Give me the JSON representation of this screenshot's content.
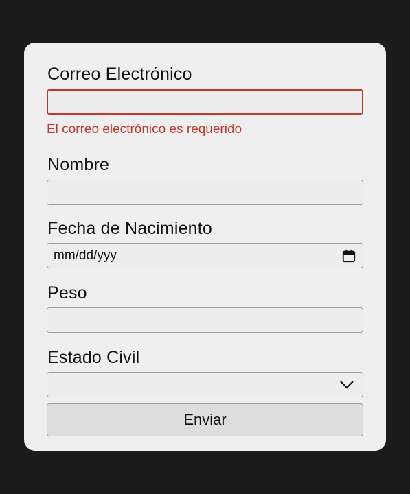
{
  "form": {
    "email": {
      "label": "Correo Electrónico",
      "value": "",
      "error": "El correo electrónico es requerido"
    },
    "name": {
      "label": "Nombre",
      "value": ""
    },
    "birthdate": {
      "label": "Fecha de Nacimiento",
      "placeholder": "mm/dd/yyy",
      "icon": "calendar-icon"
    },
    "weight": {
      "label": "Peso",
      "value": ""
    },
    "marital_status": {
      "label": "Estado Civil",
      "selected": "",
      "icon": "chevron-down-icon"
    },
    "submit_label": "Enviar"
  },
  "colors": {
    "error": "#c0392b",
    "card": "#efefef",
    "background": "#1c1c1c"
  }
}
